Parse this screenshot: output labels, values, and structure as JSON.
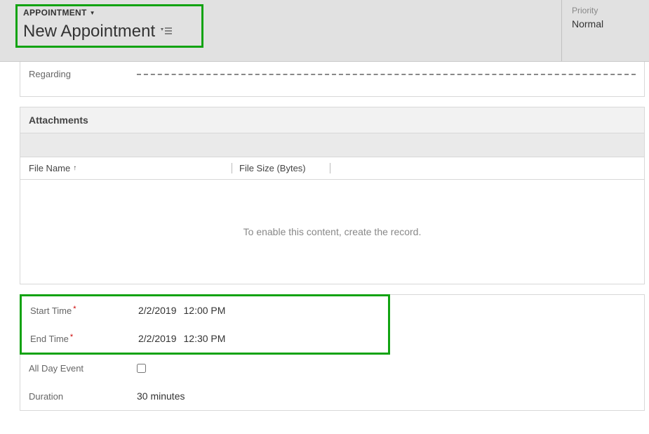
{
  "header": {
    "entity_type": "APPOINTMENT",
    "title": "New Appointment",
    "priority_label": "Priority",
    "priority_value": "Normal"
  },
  "regarding": {
    "label": "Regarding"
  },
  "attachments": {
    "section_title": "Attachments",
    "columns": {
      "filename": "File Name",
      "filesize": "File Size (Bytes)"
    },
    "empty_message": "To enable this content, create the record."
  },
  "times": {
    "start": {
      "label": "Start Time",
      "date": "2/2/2019",
      "time": "12:00 PM"
    },
    "end": {
      "label": "End Time",
      "date": "2/2/2019",
      "time": "12:30 PM"
    },
    "allday": {
      "label": "All Day Event",
      "checked": false
    },
    "duration": {
      "label": "Duration",
      "value": "30 minutes"
    }
  }
}
